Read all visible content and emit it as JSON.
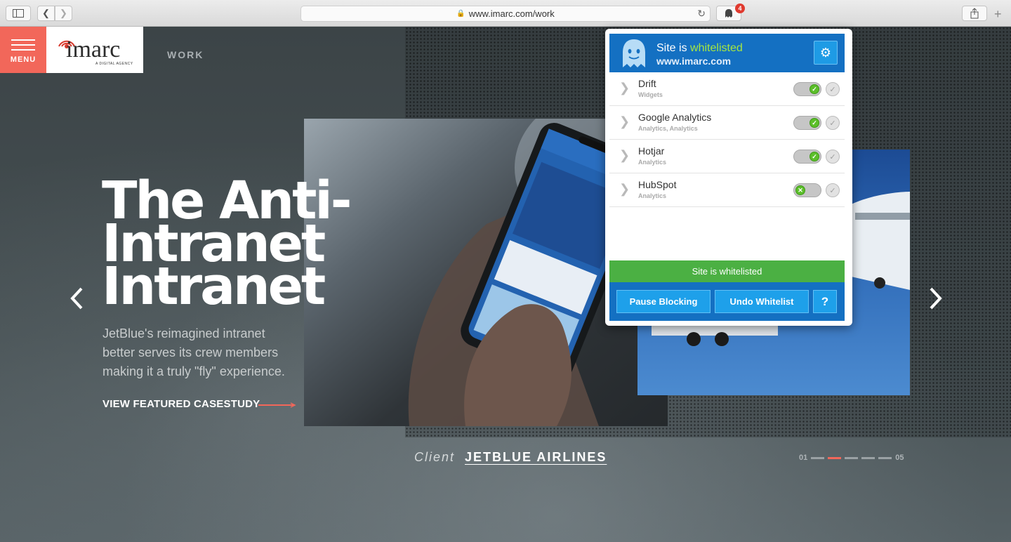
{
  "browser": {
    "url": "www.imarc.com/work",
    "extension_badge": "4"
  },
  "site": {
    "menu_label": "MENU",
    "logo_text": "imarc",
    "logo_sub": "A DIGITAL AGENCY",
    "nav_work": "WORK",
    "headline_lines": [
      "The Anti-",
      "Intranet",
      "Intranet"
    ],
    "description": "JetBlue's reimagined intranet better serves its crew members making it a truly \"fly\" experience.",
    "cta": "VIEW FEATURED CASESTUDY",
    "client_label": "Client",
    "client_name": "JETBLUE AIRLINES",
    "pager": {
      "start": "01",
      "end": "05",
      "total": 5,
      "active_index": 2
    },
    "accent_color": "#f2675a"
  },
  "ghostery": {
    "title_prefix": "Site is",
    "title_status": "whitelisted",
    "domain": "www.imarc.com",
    "trackers": [
      {
        "name": "Drift",
        "category": "Widgets",
        "enabled": true
      },
      {
        "name": "Google Analytics",
        "category": "Analytics, Analytics",
        "enabled": true
      },
      {
        "name": "Hotjar",
        "category": "Analytics",
        "enabled": true
      },
      {
        "name": "HubSpot",
        "category": "Analytics",
        "enabled": false
      }
    ],
    "status_text": "Site is whitelisted",
    "buttons": {
      "pause": "Pause Blocking",
      "undo": "Undo Whitelist",
      "help": "?"
    },
    "colors": {
      "header": "#1470c2",
      "status": "#4bb043",
      "highlight": "#a6e640"
    }
  }
}
